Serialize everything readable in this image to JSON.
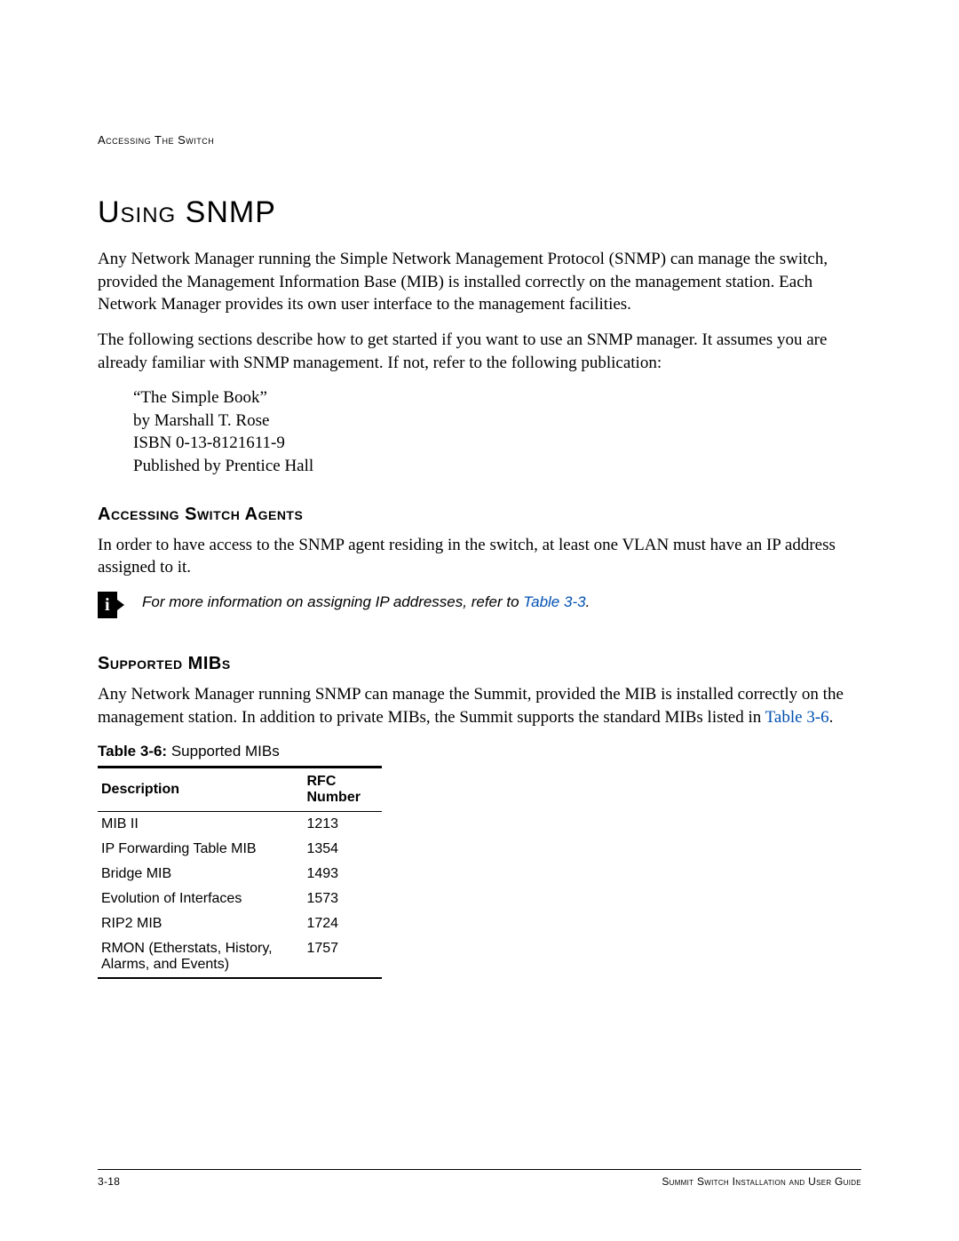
{
  "header": {
    "section": "Accessing The Switch"
  },
  "main": {
    "title": "Using SNMP",
    "para1": "Any Network Manager running the Simple Network Management Protocol (SNMP) can manage the switch, provided the Management Information Base (MIB) is installed correctly on the management station. Each Network Manager provides its own user interface to the management facilities.",
    "para2": "The following sections describe how to get started if you want to use an SNMP manager. It assumes you are already familiar with SNMP management. If not, refer to the following publication:",
    "citation": {
      "line1": "“The Simple Book”",
      "line2": "by Marshall T. Rose",
      "line3": "ISBN 0-13-8121611-9",
      "line4": "Published by Prentice Hall"
    },
    "section_agents": {
      "heading": "Accessing Switch Agents",
      "para": "In order to have access to the SNMP agent residing in the switch, at least one VLAN must have an IP address assigned to it.",
      "note_prefix": "For more information on assigning IP addresses, refer to ",
      "note_link": "Table 3-3",
      "note_suffix": "."
    },
    "section_mibs": {
      "heading": "Supported MIBs",
      "para_prefix": "Any Network Manager running SNMP can manage the Summit, provided the MIB is installed correctly on the management station. In addition to private MIBs, the Summit supports the standard MIBs listed in ",
      "para_link": "Table 3-6",
      "para_suffix": ".",
      "table_label": "Table 3-6:",
      "table_title": "Supported MIBs",
      "columns": {
        "c1": "Description",
        "c2": "RFC Number"
      },
      "rows": [
        {
          "desc": "MIB II",
          "rfc": "1213"
        },
        {
          "desc": "IP Forwarding Table MIB",
          "rfc": "1354"
        },
        {
          "desc": "Bridge MIB",
          "rfc": "1493"
        },
        {
          "desc": "Evolution of Interfaces",
          "rfc": "1573"
        },
        {
          "desc": "RIP2 MIB",
          "rfc": "1724"
        },
        {
          "desc": "RMON (Etherstats, History, Alarms, and Events)",
          "rfc": "1757"
        }
      ]
    }
  },
  "footer": {
    "page": "3-18",
    "guide": "Summit Switch Installation and User Guide"
  }
}
